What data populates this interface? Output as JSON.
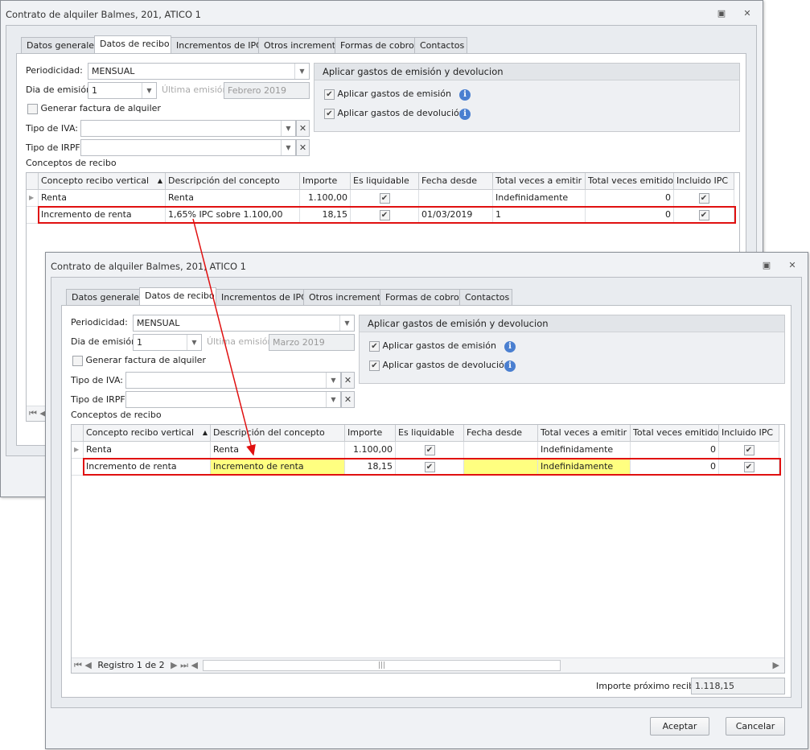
{
  "windows": [
    {
      "title": "Contrato de alquiler Balmes, 201, ATICO 1",
      "tabs": [
        "Datos generales",
        "Datos de recibo",
        "Incrementos de IPC",
        "Otros incrementos",
        "Formas de cobro",
        "Contactos"
      ],
      "active_tab": 1,
      "periodicidad_label": "Periodicidad:",
      "periodicidad": "MENSUAL",
      "dia_label": "Dia de emisión:",
      "dia": "1",
      "ultima_label": "Última emisión:",
      "ultima": "Febrero 2019",
      "generar_label": "Generar factura de alquiler",
      "generar_checked": false,
      "iva_label": "Tipo de IVA:",
      "iva": "",
      "irpf_label": "Tipo de IRPF:",
      "irpf": "",
      "group_title": "Aplicar gastos de emisión y devolucion",
      "gastos_emision": "Aplicar gastos de emisión",
      "gastos_devolucion": "Aplicar gastos de devolución",
      "conceptos_label": "Conceptos de recibo",
      "columns": [
        "Concepto recibo vertical",
        "Descripción del concepto",
        "Importe",
        "Es liquidable",
        "Fecha desde",
        "Total veces a emitir",
        "Total veces emitido",
        "Incluido IPC"
      ],
      "rows": [
        {
          "concepto": "Renta",
          "descripcion": "Renta",
          "importe": "1.100,00",
          "liquidable": true,
          "fecha": "",
          "total_emitir": "Indefinidamente",
          "total_emitido": "0",
          "ipc": true,
          "highlight": false
        },
        {
          "concepto": "Incremento de renta",
          "descripcion": "1,65% IPC sobre 1.100,00",
          "importe": "18,15",
          "liquidable": true,
          "fecha": "01/03/2019",
          "total_emitir": "1",
          "total_emitido": "0",
          "ipc": true,
          "highlight": false
        }
      ],
      "registro": "Registro 1 de 2",
      "importe_label": "Importe próximo recibo",
      "importe_proximo": "1.118,15",
      "aceptar": "Aceptar",
      "cancelar": "Cancelar"
    },
    {
      "title": "Contrato de alquiler Balmes, 201, ATICO 1",
      "tabs": [
        "Datos generales",
        "Datos de recibo",
        "Incrementos de IPC",
        "Otros incrementos",
        "Formas de cobro",
        "Contactos"
      ],
      "active_tab": 1,
      "periodicidad_label": "Periodicidad:",
      "periodicidad": "MENSUAL",
      "dia_label": "Dia de emisión:",
      "dia": "1",
      "ultima_label": "Última emisión:",
      "ultima": "Marzo 2019",
      "generar_label": "Generar factura de alquiler",
      "generar_checked": false,
      "iva_label": "Tipo de IVA:",
      "iva": "",
      "irpf_label": "Tipo de IRPF:",
      "irpf": "",
      "group_title": "Aplicar gastos de emisión y devolucion",
      "gastos_emision": "Aplicar gastos de emisión",
      "gastos_devolucion": "Aplicar gastos de devolución",
      "conceptos_label": "Conceptos de recibo",
      "columns": [
        "Concepto recibo vertical",
        "Descripción del concepto",
        "Importe",
        "Es liquidable",
        "Fecha desde",
        "Total veces a emitir",
        "Total veces emitido",
        "Incluido IPC"
      ],
      "rows": [
        {
          "concepto": "Renta",
          "descripcion": "Renta",
          "importe": "1.100,00",
          "liquidable": true,
          "fecha": "",
          "total_emitir": "Indefinidamente",
          "total_emitido": "0",
          "ipc": true,
          "highlight": false
        },
        {
          "concepto": "Incremento de renta",
          "descripcion": "Incremento de renta",
          "importe": "18,15",
          "liquidable": true,
          "fecha": "",
          "total_emitir": "Indefinidamente",
          "total_emitido": "0",
          "ipc": true,
          "highlight": true
        }
      ],
      "registro": "Registro 1 de 2",
      "importe_label": "Importe próximo recibo",
      "importe_proximo": "1.118,15",
      "aceptar": "Aceptar",
      "cancelar": "Cancelar"
    }
  ],
  "colors": {
    "annotation": "#e01010",
    "highlight": "#ffff80"
  }
}
